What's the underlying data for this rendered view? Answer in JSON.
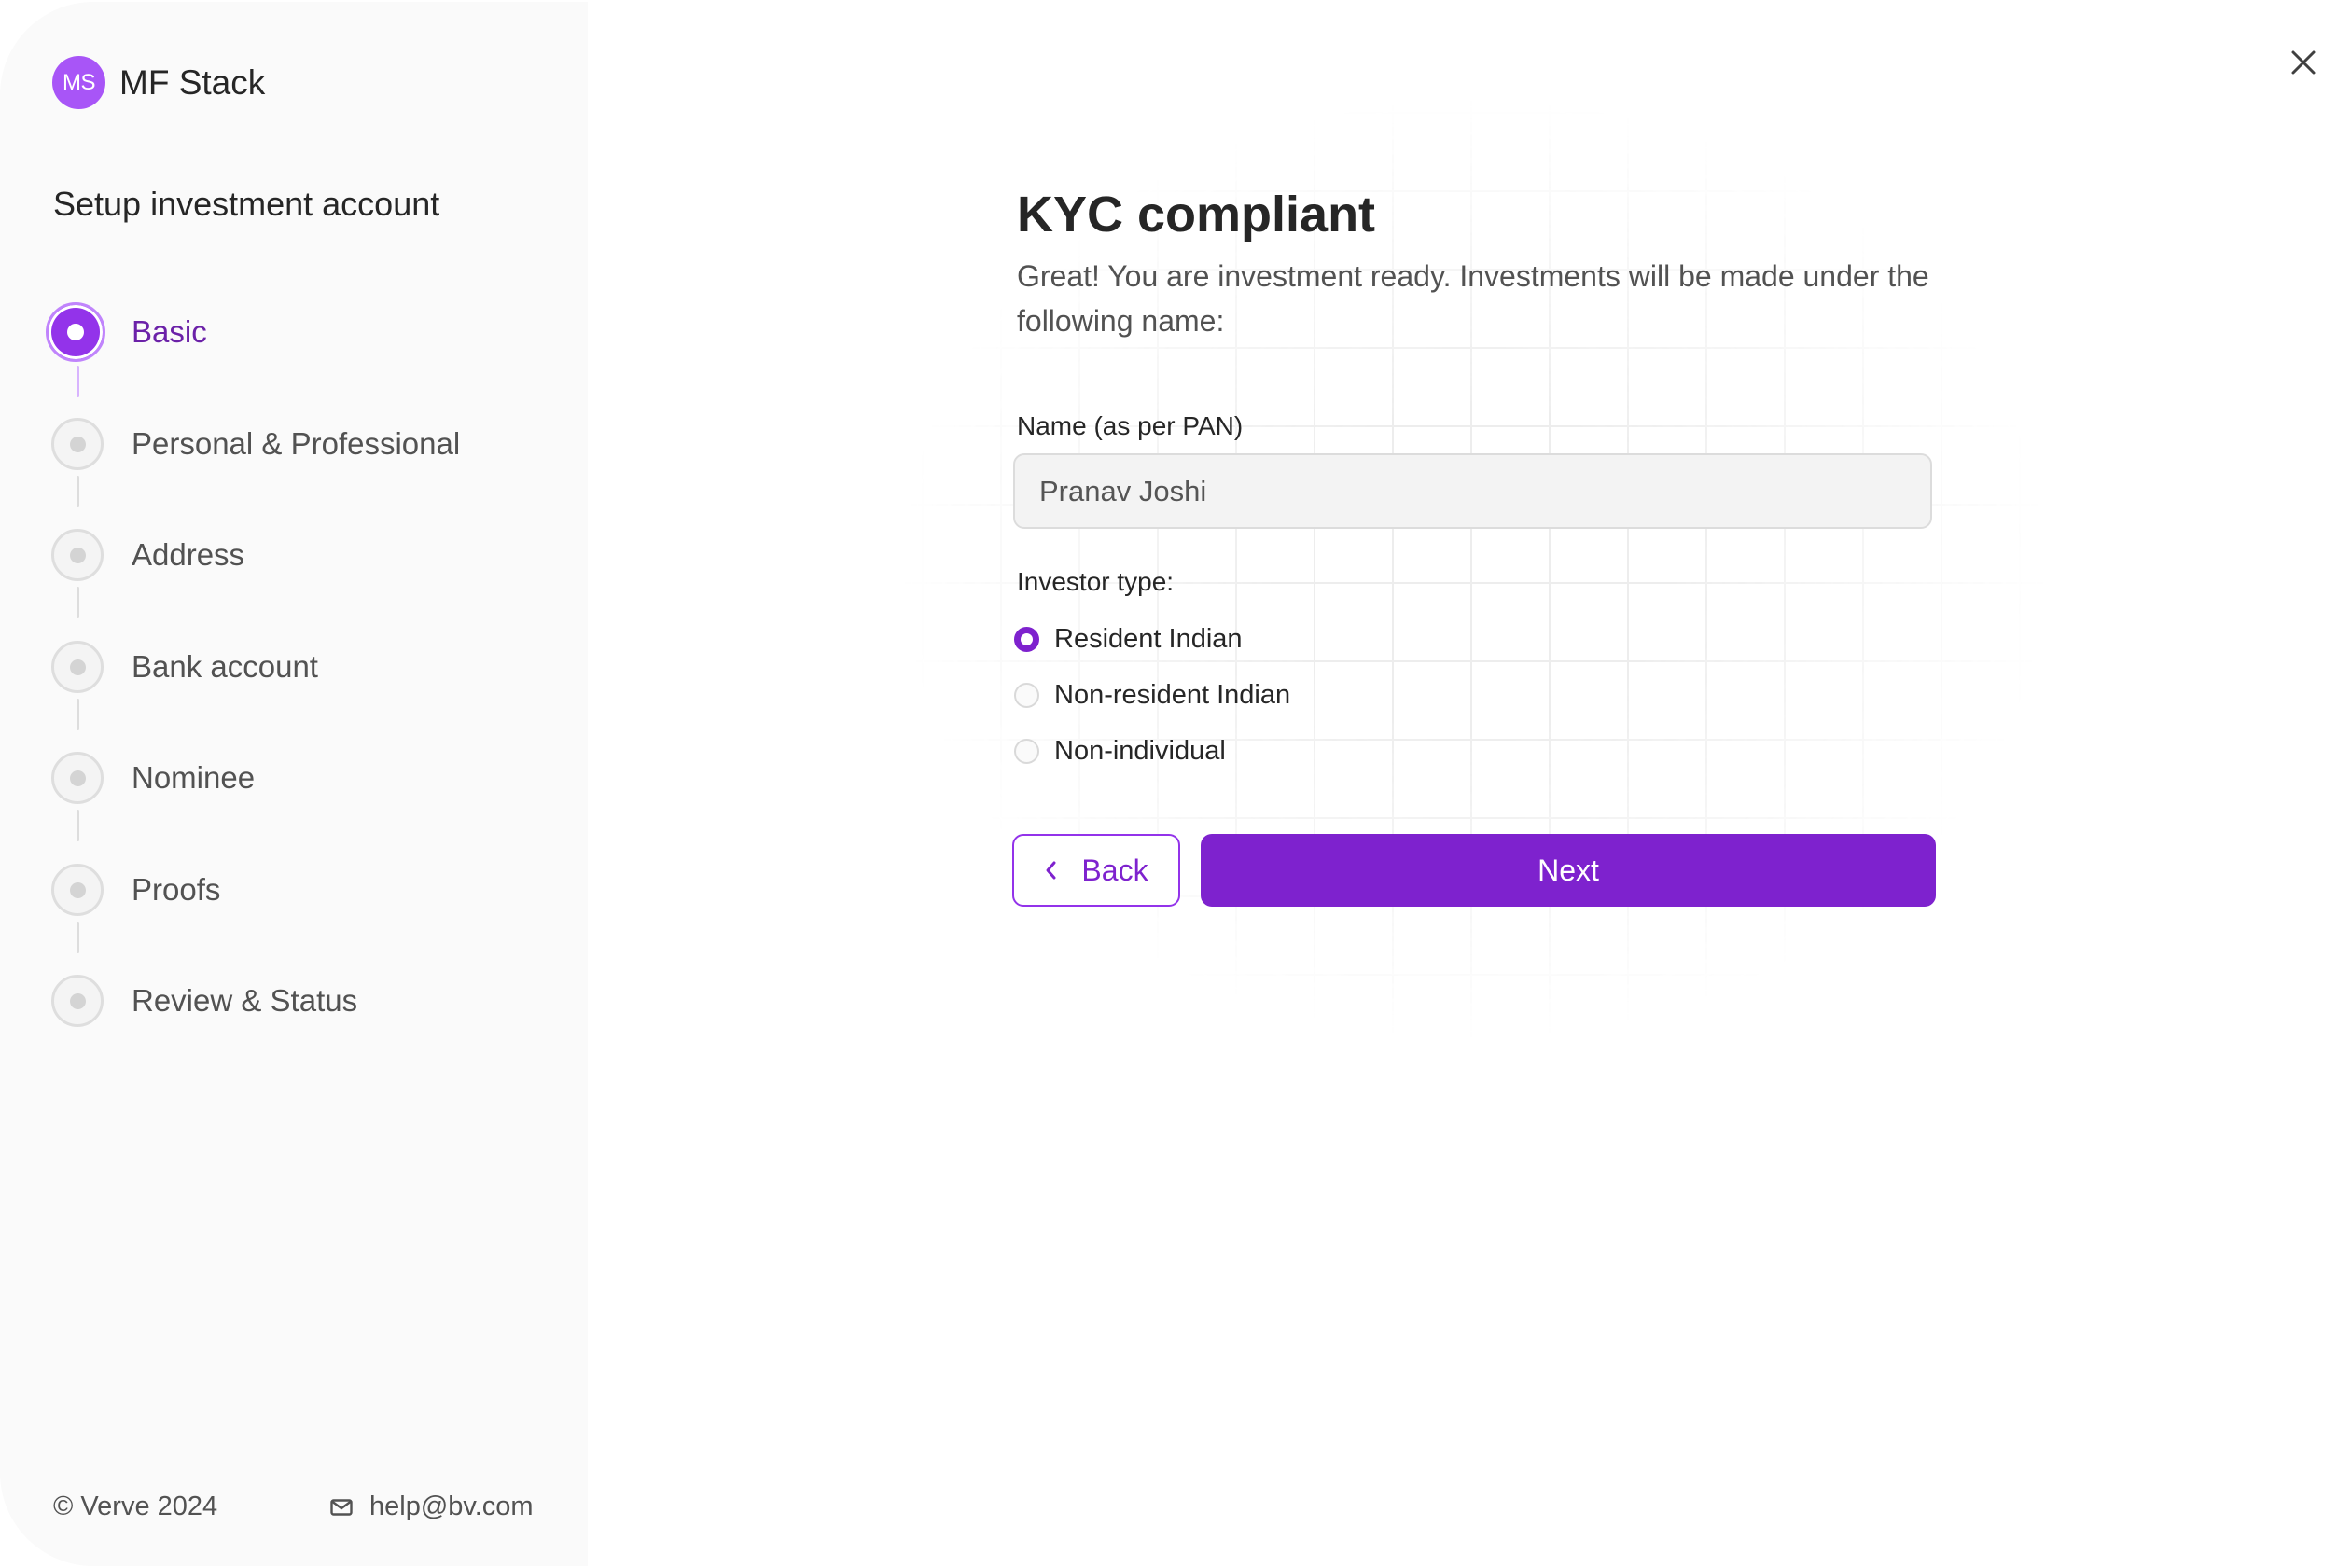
{
  "brand": {
    "logo_initials": "MS",
    "name": "MF Stack",
    "logo_color": "#a855f7"
  },
  "sidebar": {
    "title": "Setup investment account",
    "steps": [
      {
        "label": "Basic",
        "status": "active"
      },
      {
        "label": "Personal & Professional",
        "status": "pending"
      },
      {
        "label": "Address",
        "status": "pending"
      },
      {
        "label": "Bank account",
        "status": "pending"
      },
      {
        "label": "Nominee",
        "status": "pending"
      },
      {
        "label": "Proofs",
        "status": "pending"
      },
      {
        "label": "Review & Status",
        "status": "pending"
      }
    ],
    "footer": {
      "copyright": "© Verve 2024",
      "email": "help@bv.com",
      "email_icon": "mail-icon"
    }
  },
  "main": {
    "close_icon": "close-icon",
    "title": "KYC compliant",
    "description": "Great! You are investment ready. Investments will be made under the following name:",
    "name_field": {
      "label": "Name (as per PAN)",
      "value": "Pranav Joshi"
    },
    "investor_type": {
      "label": "Investor type:",
      "options": [
        {
          "label": "Resident Indian",
          "selected": true
        },
        {
          "label": "Non-resident Indian",
          "selected": false
        },
        {
          "label": "Non-individual",
          "selected": false
        }
      ]
    },
    "buttons": {
      "back": "Back",
      "next": "Next"
    }
  },
  "colors": {
    "accent": "#7e22ce",
    "active_step": "#9333ea",
    "active_step_ring": "#c084fc",
    "active_label": "#6b21a8",
    "sidebar_bg": "#fafafa"
  }
}
